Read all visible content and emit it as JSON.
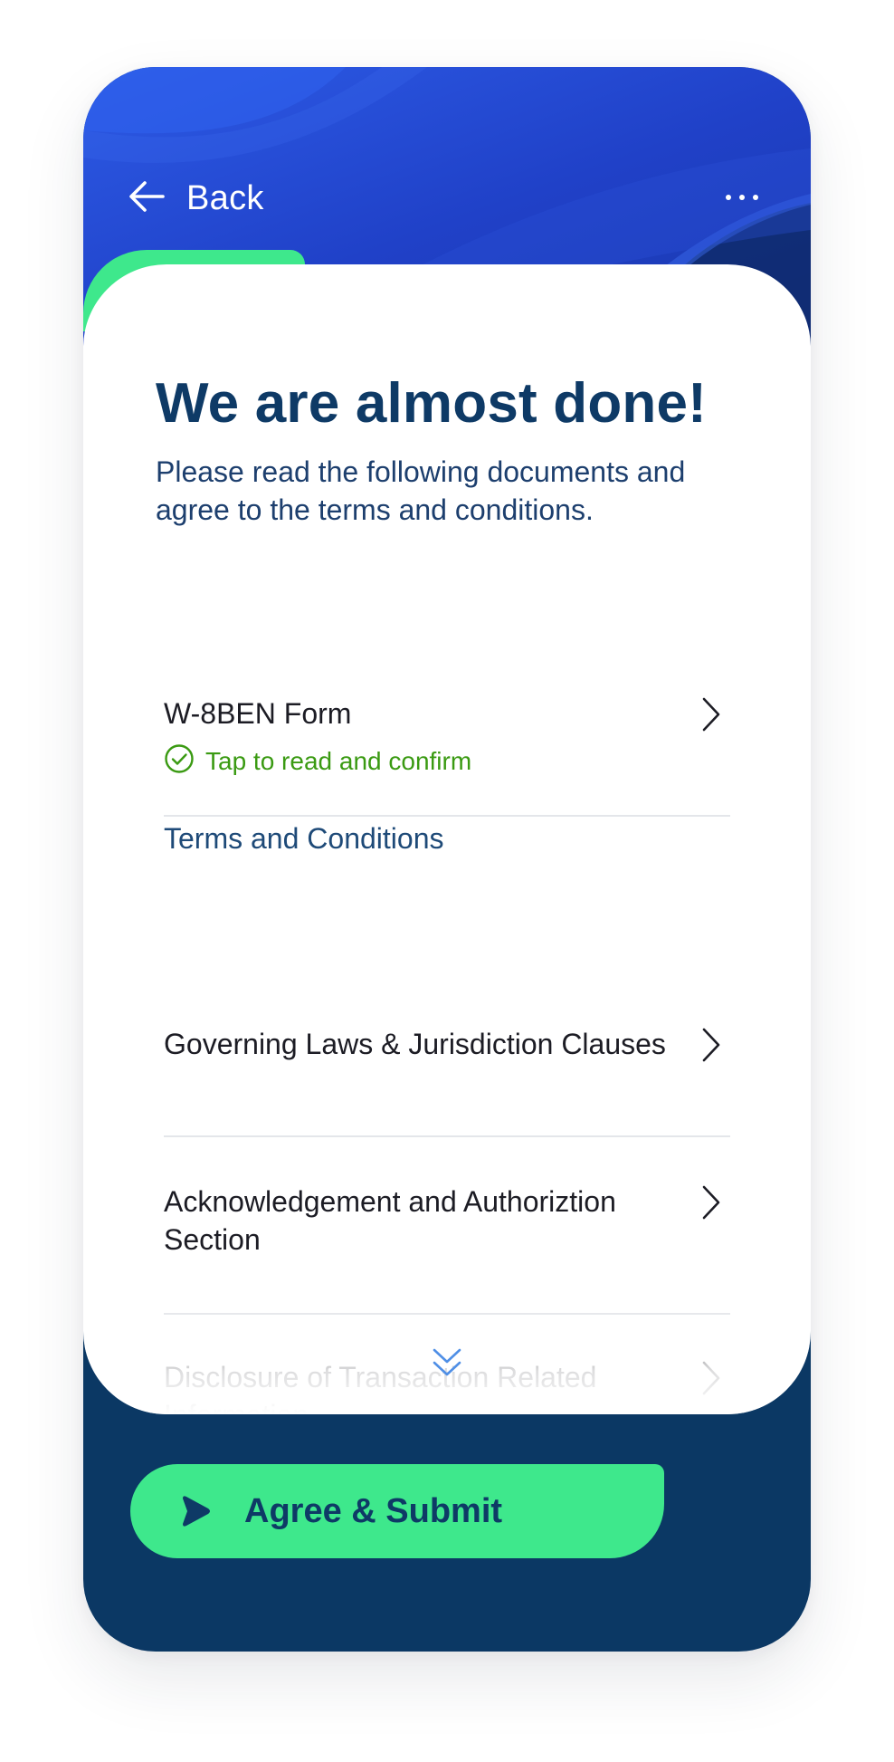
{
  "header": {
    "back_label": "Back",
    "back_icon": "arrow-left-icon",
    "more_icon": "more-horizontal-icon"
  },
  "main": {
    "title": "We are almost done!",
    "subtitle": "Please read the following documents and agree to the terms and conditions."
  },
  "documents": [
    {
      "title": "W-8BEN Form",
      "status": "Tap to read and confirm",
      "status_icon": "check-circle-icon"
    }
  ],
  "terms_section": {
    "label": "Terms and Conditions",
    "items": [
      {
        "title": "Governing Laws & Jurisdiction Clauses"
      },
      {
        "title": "Acknowledgement and Authoriztion Section"
      },
      {
        "title": "Disclosure of Transaction Related Information"
      }
    ]
  },
  "footer": {
    "submit_label": "Agree & Submit",
    "submit_icon": "play-icon",
    "scroll_icon": "double-chevron-down-icon"
  },
  "colors": {
    "header_blue": "#2041c8",
    "accent_green": "#3ee88c",
    "navy": "#0b3864",
    "status_green": "#3a9a12",
    "title_navy": "#0e3a66"
  }
}
